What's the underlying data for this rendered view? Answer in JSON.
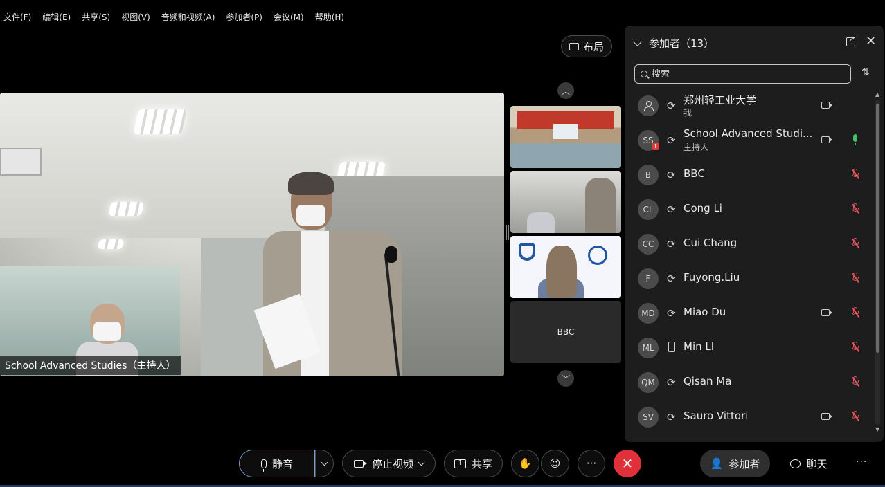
{
  "menu": [
    "文件(F)",
    "编辑(E)",
    "共享(S)",
    "视图(V)",
    "音频和视频(A)",
    "参加者(P)",
    "会议(M)",
    "帮助(H)"
  ],
  "layout_button": "布局",
  "main_video": {
    "label": "School Advanced Studies（主持人）"
  },
  "thumbnails": {
    "fourth_label": "BBC"
  },
  "panel": {
    "title": "参加者（13）",
    "search_placeholder": "搜索",
    "participants": [
      {
        "initials": "",
        "name": "郑州轻工业大学",
        "role": "我",
        "connection": "computer-audio",
        "video": true,
        "mic": "none"
      },
      {
        "initials": "SS",
        "name": "School Advanced Studi...",
        "role": "主持人",
        "connection": "computer-audio",
        "video": true,
        "mic": "on",
        "sharing": true
      },
      {
        "initials": "B",
        "name": "BBC",
        "role": "",
        "connection": "computer-audio",
        "video": false,
        "mic": "muted"
      },
      {
        "initials": "CL",
        "name": "Cong Li",
        "role": "",
        "connection": "computer-audio",
        "video": false,
        "mic": "muted"
      },
      {
        "initials": "CC",
        "name": "Cui Chang",
        "role": "",
        "connection": "computer-audio",
        "video": false,
        "mic": "muted"
      },
      {
        "initials": "F",
        "name": "Fuyong.Liu",
        "role": "",
        "connection": "computer-audio",
        "video": false,
        "mic": "muted"
      },
      {
        "initials": "MD",
        "name": "Miao Du",
        "role": "",
        "connection": "computer-audio",
        "video": true,
        "mic": "muted"
      },
      {
        "initials": "ML",
        "name": "Min LI",
        "role": "",
        "connection": "mobile",
        "video": false,
        "mic": "muted"
      },
      {
        "initials": "QM",
        "name": "Qisan Ma",
        "role": "",
        "connection": "computer-audio",
        "video": false,
        "mic": "muted"
      },
      {
        "initials": "SV",
        "name": "Sauro Vittori",
        "role": "",
        "connection": "computer-audio",
        "video": true,
        "mic": "muted"
      }
    ]
  },
  "toolbar": {
    "mute": "静音",
    "stop_video": "停止视频",
    "share": "共享",
    "participants": "参加者",
    "chat": "聊天"
  },
  "colors": {
    "end_call": "#e0303a",
    "muted_mic": "#e5535d",
    "active_mic": "#3ec26a",
    "mute_border": "#7aa0d6"
  }
}
